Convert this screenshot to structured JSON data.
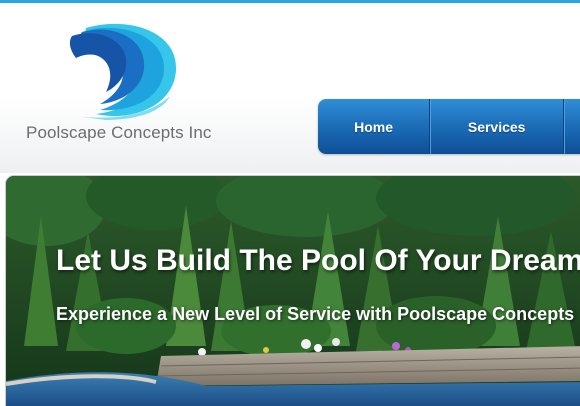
{
  "brand": {
    "name": "Poolscape Concepts Inc",
    "logo": "wave-logo"
  },
  "nav": {
    "items": [
      "Home",
      "Services"
    ]
  },
  "hero": {
    "title": "Let Us Build The Pool Of Your Dream",
    "subtitle": "Experience a New Level of Service with Poolscape Concepts"
  },
  "colors": {
    "accent": "#2aa6dc",
    "nav": "#1d6fba",
    "brand_text": "#6b6e70"
  }
}
